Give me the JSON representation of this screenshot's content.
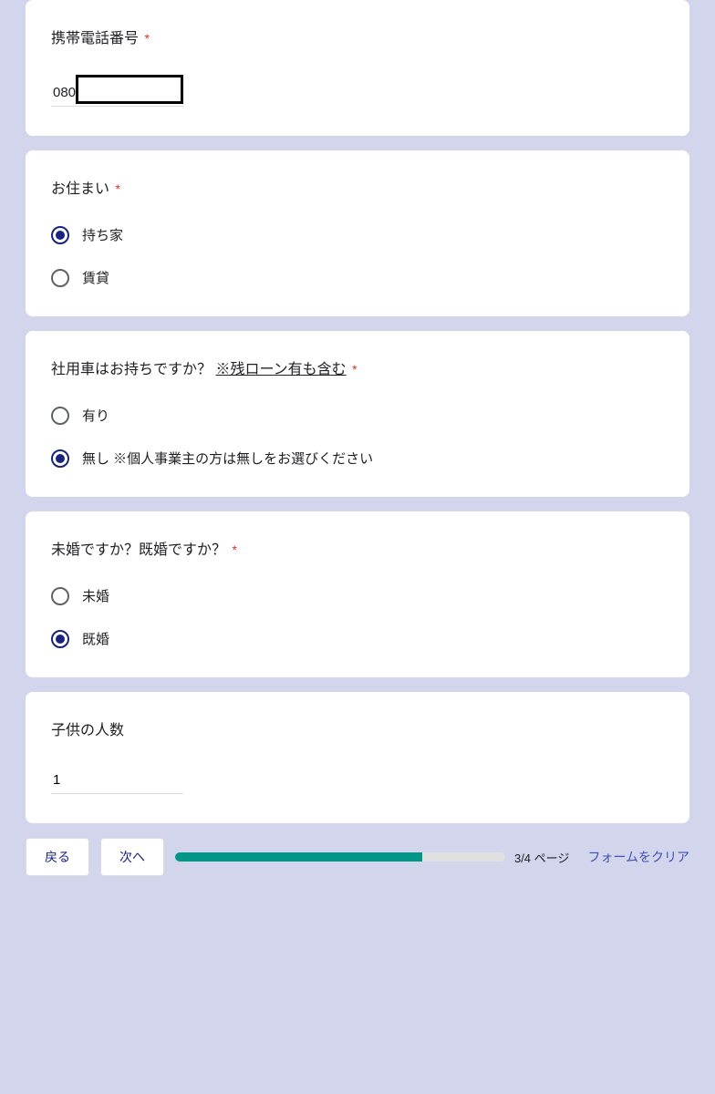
{
  "colors": {
    "accent": "#1a237e",
    "required": "#d93025",
    "progress": "#009688"
  },
  "q_phone": {
    "label": "携帯電話番号",
    "required": true,
    "value_prefix": "080",
    "value_redacted": true
  },
  "q_housing": {
    "label": "お住まい",
    "required": true,
    "options": [
      "持ち家",
      "賃貸"
    ],
    "selected_index": 0
  },
  "q_company_car": {
    "label": "社用車はお持ちですか？",
    "note": "※残ローン有も含む",
    "required": true,
    "options": [
      "有り",
      "無し ※個人事業主の方は無しをお選びください"
    ],
    "selected_index": 1
  },
  "q_marital": {
    "label": "未婚ですか？既婚ですか？",
    "required": true,
    "options": [
      "未婚",
      "既婚"
    ],
    "selected_index": 1
  },
  "q_children": {
    "label": "子供の人数",
    "required": false,
    "value": "1"
  },
  "footer": {
    "back": "戻る",
    "next": "次へ",
    "page_label": "3/4 ページ",
    "progress_percent": 75,
    "clear": "フォームをクリア"
  }
}
